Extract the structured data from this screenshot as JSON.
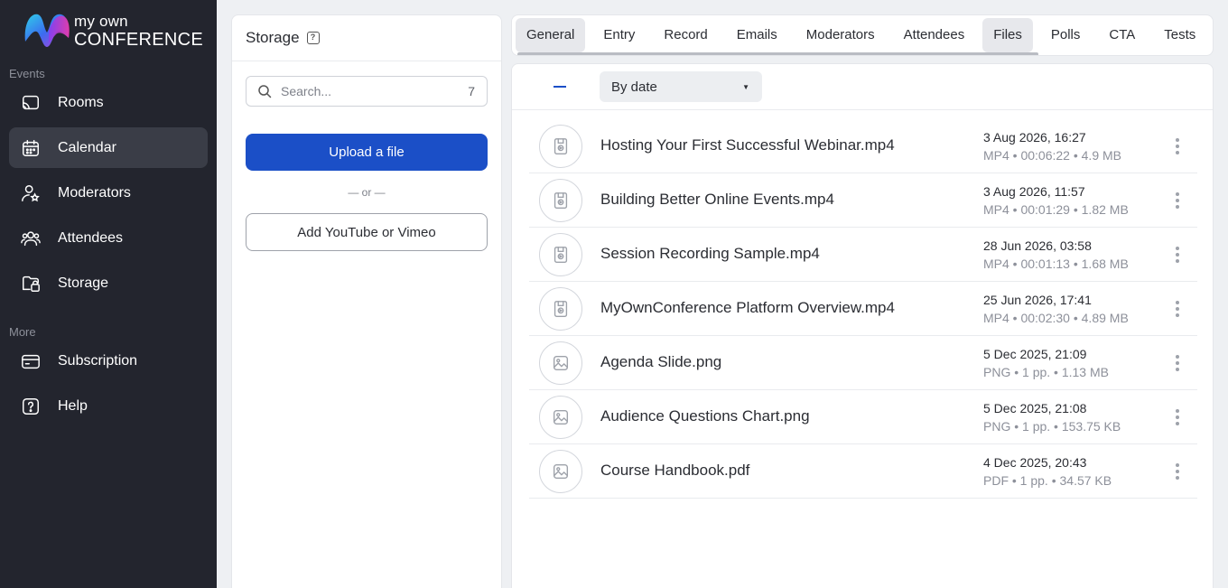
{
  "brand": {
    "line1": "my own",
    "line2": "CONFERENCE"
  },
  "sidebar": {
    "section_events": "Events",
    "section_more": "More",
    "items": [
      {
        "label": "Rooms",
        "icon": "cast-icon"
      },
      {
        "label": "Calendar",
        "icon": "calendar-icon",
        "active": true
      },
      {
        "label": "Moderators",
        "icon": "user-star-icon"
      },
      {
        "label": "Attendees",
        "icon": "users-icon"
      },
      {
        "label": "Storage",
        "icon": "folder-icon"
      }
    ],
    "more_items": [
      {
        "label": "Subscription",
        "icon": "wallet-icon"
      },
      {
        "label": "Help",
        "icon": "question-icon"
      }
    ]
  },
  "storage": {
    "title": "Storage",
    "help_badge": "?",
    "search_placeholder": "Search...",
    "count": "7",
    "upload_label": "Upload a file",
    "or_label": "— or —",
    "youtube_label": "Add YouTube or Vimeo"
  },
  "tabs": [
    "General",
    "Entry",
    "Record",
    "Emails",
    "Moderators",
    "Attendees",
    "Files",
    "Polls",
    "CTA",
    "Tests"
  ],
  "active_tab": "Files",
  "toolbar": {
    "sort_value": "By date",
    "sort_arrow": "▼"
  },
  "files": [
    {
      "name": "Hosting Your First Successful Webinar.mp4",
      "date": "3 Aug 2026, 16:27",
      "meta": "MP4 • 00:06:22 • 4.9 MB",
      "type": "video"
    },
    {
      "name": "Building Better Online Events.mp4",
      "date": "3 Aug 2026, 11:57",
      "meta": "MP4 • 00:01:29 • 1.82 MB",
      "type": "video"
    },
    {
      "name": "Session Recording Sample.mp4",
      "date": "28 Jun 2026, 03:58",
      "meta": "MP4 • 00:01:13 • 1.68 MB",
      "type": "video"
    },
    {
      "name": "MyOwnConference Platform Overview.mp4",
      "date": "25 Jun 2026, 17:41",
      "meta": "MP4 • 00:02:30 • 4.89 MB",
      "type": "video"
    },
    {
      "name": "Agenda Slide.png",
      "date": "5 Dec 2025, 21:09",
      "meta": "PNG • 1 pp. • 1.13 MB",
      "type": "image"
    },
    {
      "name": "Audience Questions Chart.png",
      "date": "5 Dec 2025, 21:08",
      "meta": "PNG • 1 pp. • 153.75 KB",
      "type": "image"
    },
    {
      "name": "Course Handbook.pdf",
      "date": "4 Dec 2025, 20:43",
      "meta": "PDF • 1 pp. • 34.57 KB",
      "type": "image"
    }
  ],
  "colors": {
    "sidebar_bg": "#23252e",
    "primary": "#1b4fc7",
    "active_nav": "#3a3d47"
  }
}
